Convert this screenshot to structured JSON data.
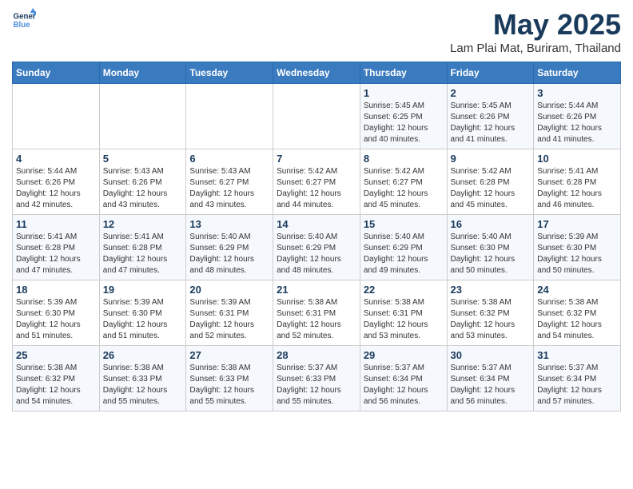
{
  "header": {
    "logo_line1": "General",
    "logo_line2": "Blue",
    "month_title": "May 2025",
    "location": "Lam Plai Mat, Buriram, Thailand"
  },
  "weekdays": [
    "Sunday",
    "Monday",
    "Tuesday",
    "Wednesday",
    "Thursday",
    "Friday",
    "Saturday"
  ],
  "weeks": [
    [
      {
        "day": "",
        "info": ""
      },
      {
        "day": "",
        "info": ""
      },
      {
        "day": "",
        "info": ""
      },
      {
        "day": "",
        "info": ""
      },
      {
        "day": "1",
        "info": "Sunrise: 5:45 AM\nSunset: 6:25 PM\nDaylight: 12 hours\nand 40 minutes."
      },
      {
        "day": "2",
        "info": "Sunrise: 5:45 AM\nSunset: 6:26 PM\nDaylight: 12 hours\nand 41 minutes."
      },
      {
        "day": "3",
        "info": "Sunrise: 5:44 AM\nSunset: 6:26 PM\nDaylight: 12 hours\nand 41 minutes."
      }
    ],
    [
      {
        "day": "4",
        "info": "Sunrise: 5:44 AM\nSunset: 6:26 PM\nDaylight: 12 hours\nand 42 minutes."
      },
      {
        "day": "5",
        "info": "Sunrise: 5:43 AM\nSunset: 6:26 PM\nDaylight: 12 hours\nand 43 minutes."
      },
      {
        "day": "6",
        "info": "Sunrise: 5:43 AM\nSunset: 6:27 PM\nDaylight: 12 hours\nand 43 minutes."
      },
      {
        "day": "7",
        "info": "Sunrise: 5:42 AM\nSunset: 6:27 PM\nDaylight: 12 hours\nand 44 minutes."
      },
      {
        "day": "8",
        "info": "Sunrise: 5:42 AM\nSunset: 6:27 PM\nDaylight: 12 hours\nand 45 minutes."
      },
      {
        "day": "9",
        "info": "Sunrise: 5:42 AM\nSunset: 6:28 PM\nDaylight: 12 hours\nand 45 minutes."
      },
      {
        "day": "10",
        "info": "Sunrise: 5:41 AM\nSunset: 6:28 PM\nDaylight: 12 hours\nand 46 minutes."
      }
    ],
    [
      {
        "day": "11",
        "info": "Sunrise: 5:41 AM\nSunset: 6:28 PM\nDaylight: 12 hours\nand 47 minutes."
      },
      {
        "day": "12",
        "info": "Sunrise: 5:41 AM\nSunset: 6:28 PM\nDaylight: 12 hours\nand 47 minutes."
      },
      {
        "day": "13",
        "info": "Sunrise: 5:40 AM\nSunset: 6:29 PM\nDaylight: 12 hours\nand 48 minutes."
      },
      {
        "day": "14",
        "info": "Sunrise: 5:40 AM\nSunset: 6:29 PM\nDaylight: 12 hours\nand 48 minutes."
      },
      {
        "day": "15",
        "info": "Sunrise: 5:40 AM\nSunset: 6:29 PM\nDaylight: 12 hours\nand 49 minutes."
      },
      {
        "day": "16",
        "info": "Sunrise: 5:40 AM\nSunset: 6:30 PM\nDaylight: 12 hours\nand 50 minutes."
      },
      {
        "day": "17",
        "info": "Sunrise: 5:39 AM\nSunset: 6:30 PM\nDaylight: 12 hours\nand 50 minutes."
      }
    ],
    [
      {
        "day": "18",
        "info": "Sunrise: 5:39 AM\nSunset: 6:30 PM\nDaylight: 12 hours\nand 51 minutes."
      },
      {
        "day": "19",
        "info": "Sunrise: 5:39 AM\nSunset: 6:30 PM\nDaylight: 12 hours\nand 51 minutes."
      },
      {
        "day": "20",
        "info": "Sunrise: 5:39 AM\nSunset: 6:31 PM\nDaylight: 12 hours\nand 52 minutes."
      },
      {
        "day": "21",
        "info": "Sunrise: 5:38 AM\nSunset: 6:31 PM\nDaylight: 12 hours\nand 52 minutes."
      },
      {
        "day": "22",
        "info": "Sunrise: 5:38 AM\nSunset: 6:31 PM\nDaylight: 12 hours\nand 53 minutes."
      },
      {
        "day": "23",
        "info": "Sunrise: 5:38 AM\nSunset: 6:32 PM\nDaylight: 12 hours\nand 53 minutes."
      },
      {
        "day": "24",
        "info": "Sunrise: 5:38 AM\nSunset: 6:32 PM\nDaylight: 12 hours\nand 54 minutes."
      }
    ],
    [
      {
        "day": "25",
        "info": "Sunrise: 5:38 AM\nSunset: 6:32 PM\nDaylight: 12 hours\nand 54 minutes."
      },
      {
        "day": "26",
        "info": "Sunrise: 5:38 AM\nSunset: 6:33 PM\nDaylight: 12 hours\nand 55 minutes."
      },
      {
        "day": "27",
        "info": "Sunrise: 5:38 AM\nSunset: 6:33 PM\nDaylight: 12 hours\nand 55 minutes."
      },
      {
        "day": "28",
        "info": "Sunrise: 5:37 AM\nSunset: 6:33 PM\nDaylight: 12 hours\nand 55 minutes."
      },
      {
        "day": "29",
        "info": "Sunrise: 5:37 AM\nSunset: 6:34 PM\nDaylight: 12 hours\nand 56 minutes."
      },
      {
        "day": "30",
        "info": "Sunrise: 5:37 AM\nSunset: 6:34 PM\nDaylight: 12 hours\nand 56 minutes."
      },
      {
        "day": "31",
        "info": "Sunrise: 5:37 AM\nSunset: 6:34 PM\nDaylight: 12 hours\nand 57 minutes."
      }
    ]
  ]
}
